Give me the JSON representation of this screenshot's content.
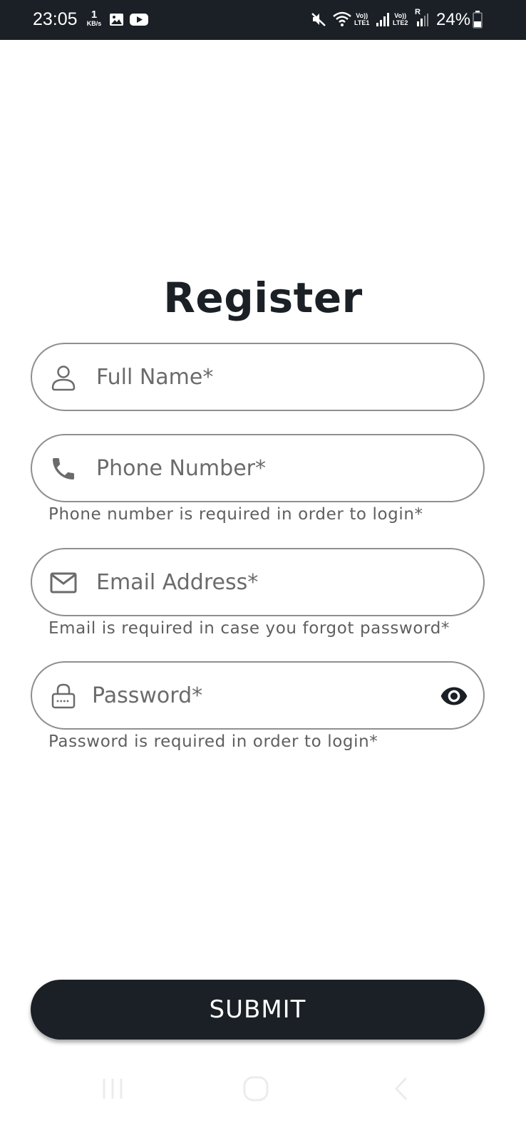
{
  "status_bar": {
    "time": "23:05",
    "net_speed_value": "1",
    "net_speed_unit": "KB/s",
    "sim1_volte": "Vo))",
    "sim1_lte": "LTE1",
    "sim2_volte": "Vo))",
    "sim2_lte": "LTE2",
    "sim2_roaming": "R",
    "battery": "24%",
    "icons": [
      "gallery-icon",
      "youtube-icon",
      "mute-icon",
      "wifi-icon",
      "signal-icon",
      "battery-icon"
    ]
  },
  "page": {
    "title": "Register"
  },
  "form": {
    "full_name": {
      "placeholder": "Full Name*",
      "value": "",
      "icon": "user-icon"
    },
    "phone": {
      "placeholder": "Phone Number*",
      "value": "",
      "icon": "phone-icon",
      "helper": "Phone number is required in order to login*"
    },
    "email": {
      "placeholder": "Email Address*",
      "value": "",
      "icon": "mail-icon",
      "helper": "Email is required in case you forgot password*"
    },
    "password": {
      "placeholder": "Password*",
      "value": "",
      "icon": "lock-icon",
      "toggle_icon": "eye-icon",
      "helper": "Password is required in order to login*"
    },
    "submit_label": "SUBMIT"
  },
  "colors": {
    "primary": "#1b2026",
    "border": "#8f8f8f",
    "text_muted": "#5f5f5f",
    "background": "#ffffff"
  },
  "nav_bar": {
    "buttons": [
      "recents-icon",
      "home-icon",
      "back-icon"
    ]
  }
}
